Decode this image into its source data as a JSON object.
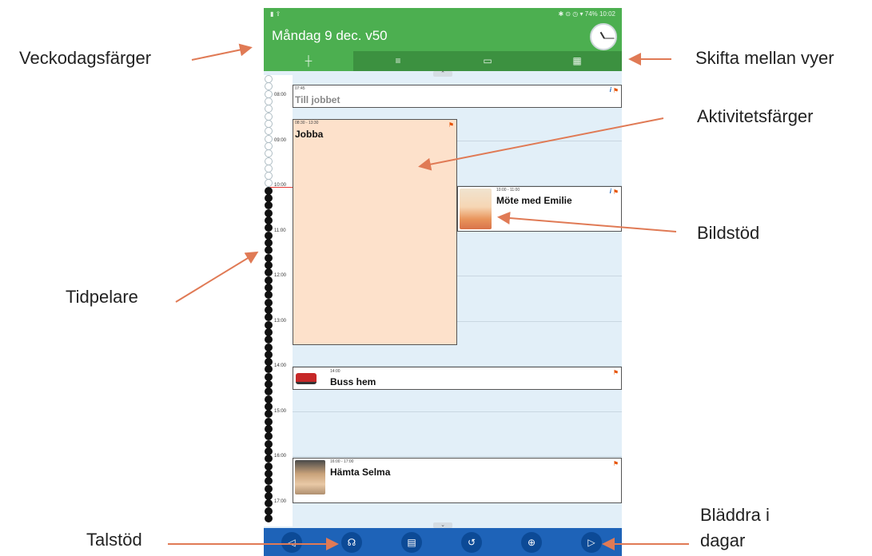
{
  "callouts": {
    "weekday_colors": "Veckodagsfärger",
    "switch_views": "Skifta mellan vyer",
    "activity_colors": "Aktivitetsfärger",
    "image_support": "Bildstöd",
    "time_pillar": "Tidpelare",
    "speech_support": "Talstöd",
    "browse_days_line1": "Bläddra i",
    "browse_days_line2": "dagar"
  },
  "status_bar": {
    "left_icons": "▮ ⇪",
    "right": "✱ ⊙ ◷ ▾ 74% 10:02"
  },
  "header": {
    "date": "Måndag 9 dec. v50",
    "clock_icon": "analog-clock-icon",
    "color": "#4caf50"
  },
  "tabs": [
    {
      "icon": "timepillar-tab-icon",
      "glyph": "┼"
    },
    {
      "icon": "list-tab-icon",
      "glyph": "≡"
    },
    {
      "icon": "week-tab-icon",
      "glyph": "▭"
    },
    {
      "icon": "month-tab-icon",
      "glyph": "▦"
    }
  ],
  "hours": [
    "08:00",
    "09:00",
    "10:00",
    "11:00",
    "12:00",
    "13:00",
    "14:00",
    "15:00",
    "16:00",
    "17:00"
  ],
  "events": {
    "till_jobbet": {
      "time": "07:45",
      "title": "Till jobbet",
      "has_info": true
    },
    "jobba": {
      "time": "08:30 - 13:30",
      "title": "Jobba",
      "color": "#fde1cb"
    },
    "mote": {
      "time": "10:00 - 11:00",
      "title": "Möte med Emilie",
      "has_info": true,
      "image": "emilie-photo"
    },
    "buss": {
      "time": "14:00",
      "title": "Buss hem",
      "image": "bus-image"
    },
    "selma": {
      "time": "16:00 - 17:00",
      "title": "Hämta Selma",
      "image": "selma-photo"
    }
  },
  "bottom_bar": [
    {
      "icon": "previous-day-icon",
      "glyph": "◁"
    },
    {
      "icon": "speech-support-icon",
      "glyph": "☊"
    },
    {
      "icon": "menu-icon",
      "glyph": "▤"
    },
    {
      "icon": "now-icon",
      "glyph": "↺"
    },
    {
      "icon": "zoom-icon",
      "glyph": "⊕"
    },
    {
      "icon": "next-day-icon",
      "glyph": "▷"
    }
  ],
  "colors": {
    "header_green": "#4caf50",
    "bottom_blue": "#1e63b8",
    "arrow_orange": "#e07a55",
    "background_blue": "#e2eff8"
  }
}
